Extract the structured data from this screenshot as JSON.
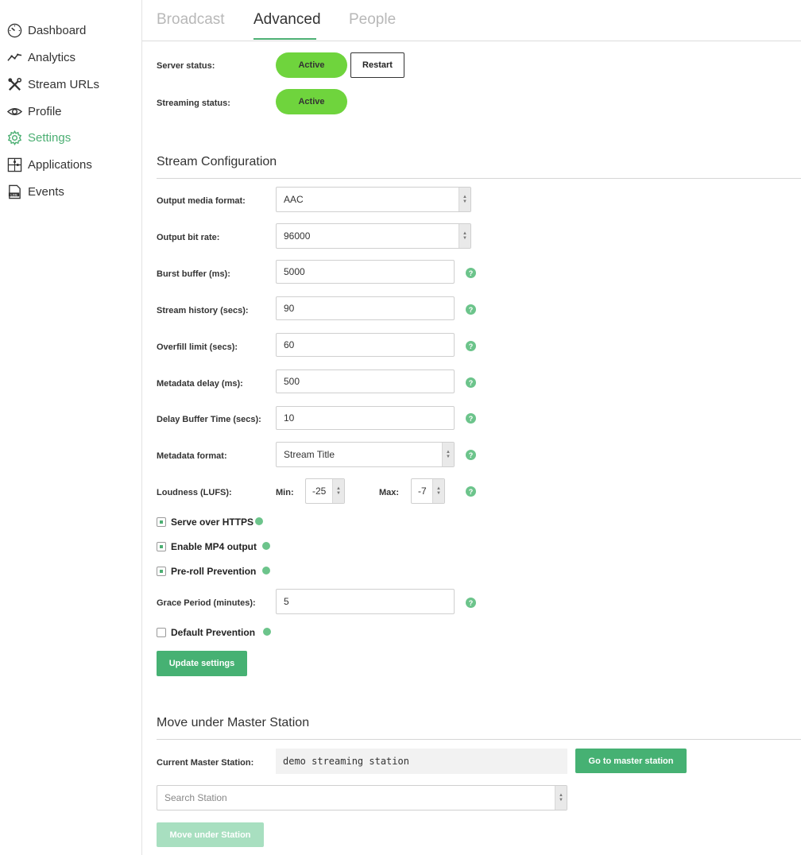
{
  "sidebar": {
    "items": [
      {
        "label": "Dashboard",
        "icon": "dashboard-gauge-icon"
      },
      {
        "label": "Analytics",
        "icon": "analytics-line-icon"
      },
      {
        "label": "Stream URLs",
        "icon": "tools-icon"
      },
      {
        "label": "Profile",
        "icon": "eye-icon"
      },
      {
        "label": "Settings",
        "icon": "gear-icon",
        "active": true
      },
      {
        "label": "Applications",
        "icon": "puzzle-icon"
      },
      {
        "label": "Events",
        "icon": "log-file-icon"
      }
    ]
  },
  "tabs": [
    {
      "label": "Broadcast"
    },
    {
      "label": "Advanced",
      "active": true
    },
    {
      "label": "People"
    }
  ],
  "status": {
    "server_label": "Server status:",
    "server_value": "Active",
    "restart_label": "Restart",
    "streaming_label": "Streaming status:",
    "streaming_value": "Active"
  },
  "stream_config": {
    "title": "Stream Configuration",
    "output_format_label": "Output media format:",
    "output_format_value": "AAC",
    "bit_rate_label": "Output bit rate:",
    "bit_rate_value": "96000",
    "burst_label": "Burst buffer (ms):",
    "burst_value": "5000",
    "history_label": "Stream history (secs):",
    "history_value": "90",
    "overfill_label": "Overfill limit (secs):",
    "overfill_value": "60",
    "meta_delay_label": "Metadata delay (ms):",
    "meta_delay_value": "500",
    "delay_buffer_label": "Delay Buffer Time (secs):",
    "delay_buffer_value": "10",
    "meta_format_label": "Metadata format:",
    "meta_format_value": "Stream Title",
    "loudness_label": "Loudness (LUFS):",
    "min_label": "Min:",
    "min_value": "-25",
    "max_label": "Max:",
    "max_value": "-7",
    "https_label": "Serve over HTTPS",
    "https_checked": true,
    "mp4_label": "Enable MP4 output",
    "mp4_checked": true,
    "preroll_label": "Pre-roll Prevention",
    "preroll_checked": true,
    "grace_label": "Grace Period (minutes):",
    "grace_value": "5",
    "default_prev_label": "Default Prevention",
    "default_prev_checked": false,
    "update_label": "Update settings",
    "help_glyph": "?"
  },
  "master": {
    "title": "Move under Master Station",
    "current_label": "Current Master Station:",
    "current_value": "demo streaming station",
    "go_label": "Go to master station",
    "search_placeholder": "Search Station",
    "move_label": "Move under Station"
  },
  "colors": {
    "accent": "#4caf73",
    "active_pill": "#6fd43d",
    "button_green": "#46b173",
    "button_disabled": "#a8dfc0"
  }
}
